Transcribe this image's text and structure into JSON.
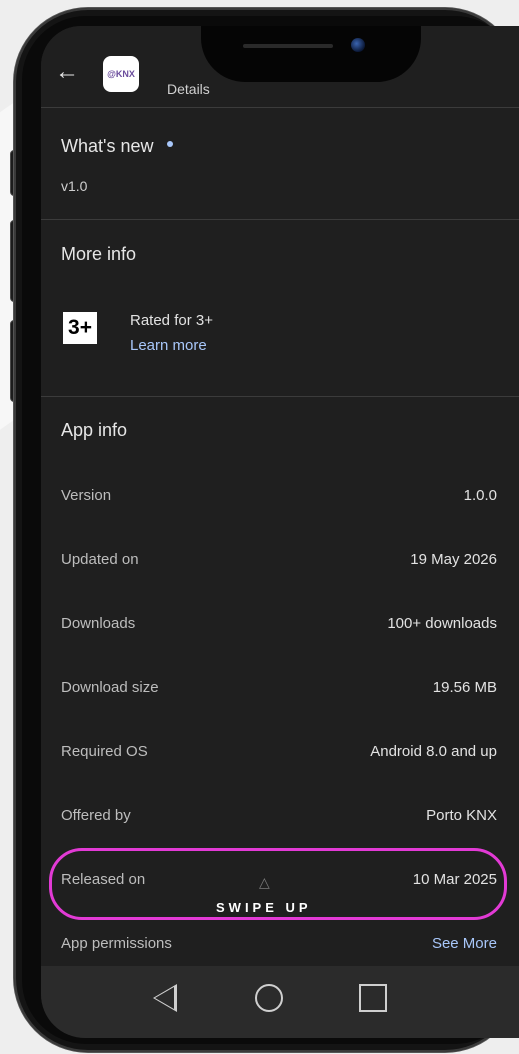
{
  "header": {
    "title": "Details",
    "app_icon_text": "@KNX"
  },
  "whats_new": {
    "heading": "What's new",
    "version_note": "v1.0"
  },
  "more_info": {
    "heading": "More info",
    "rating_badge": "3+",
    "rated_text": "Rated for 3+",
    "learn_more": "Learn more"
  },
  "app_info": {
    "heading": "App info",
    "rows": [
      {
        "label": "Version",
        "value": "1.0.0"
      },
      {
        "label": "Updated on",
        "value": "19 May 2026"
      },
      {
        "label": "Downloads",
        "value": "100+ downloads"
      },
      {
        "label": "Download size",
        "value": "19.56 MB"
      },
      {
        "label": "Required OS",
        "value": "Android 8.0 and up"
      },
      {
        "label": "Offered by",
        "value": "Porto KNX"
      },
      {
        "label": "Released on",
        "value": "10 Mar 2025"
      }
    ],
    "permissions_label": "App permissions",
    "permissions_link": "See More"
  },
  "overlay": {
    "swipe_text": "SWIPE UP"
  },
  "colors": {
    "background": "#1f1f1f",
    "accent_link": "#a8c7fa",
    "highlight": "#e23ad5"
  },
  "icons": [
    "back-arrow-icon",
    "nav-back-icon",
    "nav-home-icon",
    "nav-recents-icon"
  ]
}
